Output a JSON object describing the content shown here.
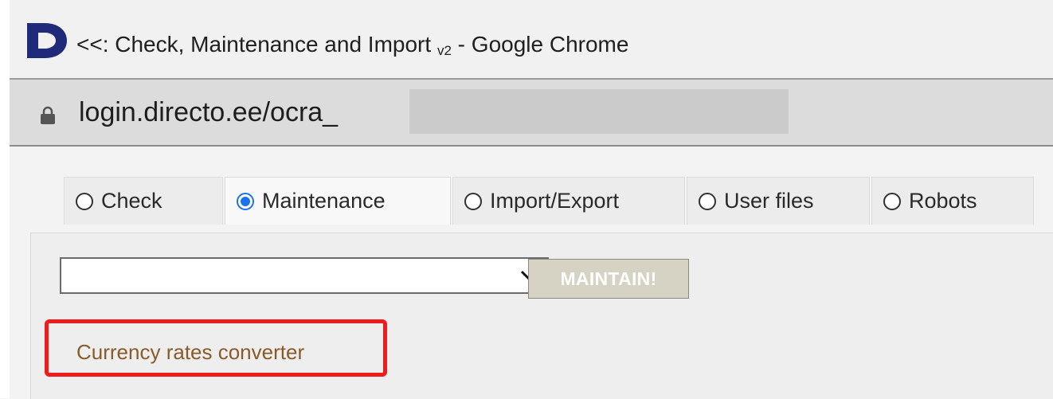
{
  "window": {
    "title_main": "<<: Check, Maintenance and Import",
    "title_suffix": "v2",
    "title_app": " - Google Chrome"
  },
  "address_bar": {
    "url": "login.directo.ee/ocra_"
  },
  "tabs": [
    {
      "label": "Check",
      "selected": false
    },
    {
      "label": "Maintenance",
      "selected": true
    },
    {
      "label": "Import/Export",
      "selected": false
    },
    {
      "label": "User files",
      "selected": false
    },
    {
      "label": "Robots",
      "selected": false
    }
  ],
  "maintenance": {
    "select_value": "",
    "maintain_button_label": "MAINTAIN!",
    "link_label": "Currency rates converter"
  },
  "colors": {
    "highlight": "#ee1c1c",
    "link": "#8a5b2a",
    "radio_selected": "#1a73e8",
    "logo": "#1f2a7a"
  }
}
